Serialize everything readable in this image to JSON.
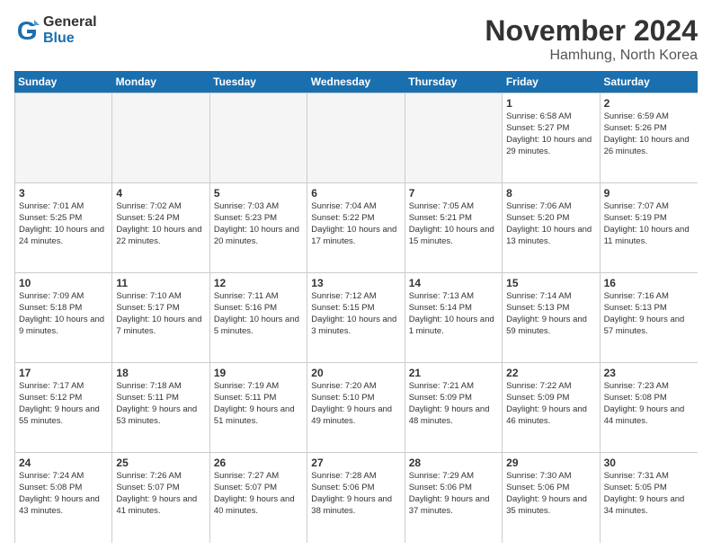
{
  "logo": {
    "general": "General",
    "blue": "Blue"
  },
  "header": {
    "month": "November 2024",
    "location": "Hamhung, North Korea"
  },
  "weekdays": [
    "Sunday",
    "Monday",
    "Tuesday",
    "Wednesday",
    "Thursday",
    "Friday",
    "Saturday"
  ],
  "weeks": [
    [
      {
        "day": "",
        "empty": true
      },
      {
        "day": "",
        "empty": true
      },
      {
        "day": "",
        "empty": true
      },
      {
        "day": "",
        "empty": true
      },
      {
        "day": "",
        "empty": true
      },
      {
        "day": "1",
        "sunrise": "Sunrise: 6:58 AM",
        "sunset": "Sunset: 5:27 PM",
        "daylight": "Daylight: 10 hours and 29 minutes."
      },
      {
        "day": "2",
        "sunrise": "Sunrise: 6:59 AM",
        "sunset": "Sunset: 5:26 PM",
        "daylight": "Daylight: 10 hours and 26 minutes."
      }
    ],
    [
      {
        "day": "3",
        "sunrise": "Sunrise: 7:01 AM",
        "sunset": "Sunset: 5:25 PM",
        "daylight": "Daylight: 10 hours and 24 minutes."
      },
      {
        "day": "4",
        "sunrise": "Sunrise: 7:02 AM",
        "sunset": "Sunset: 5:24 PM",
        "daylight": "Daylight: 10 hours and 22 minutes."
      },
      {
        "day": "5",
        "sunrise": "Sunrise: 7:03 AM",
        "sunset": "Sunset: 5:23 PM",
        "daylight": "Daylight: 10 hours and 20 minutes."
      },
      {
        "day": "6",
        "sunrise": "Sunrise: 7:04 AM",
        "sunset": "Sunset: 5:22 PM",
        "daylight": "Daylight: 10 hours and 17 minutes."
      },
      {
        "day": "7",
        "sunrise": "Sunrise: 7:05 AM",
        "sunset": "Sunset: 5:21 PM",
        "daylight": "Daylight: 10 hours and 15 minutes."
      },
      {
        "day": "8",
        "sunrise": "Sunrise: 7:06 AM",
        "sunset": "Sunset: 5:20 PM",
        "daylight": "Daylight: 10 hours and 13 minutes."
      },
      {
        "day": "9",
        "sunrise": "Sunrise: 7:07 AM",
        "sunset": "Sunset: 5:19 PM",
        "daylight": "Daylight: 10 hours and 11 minutes."
      }
    ],
    [
      {
        "day": "10",
        "sunrise": "Sunrise: 7:09 AM",
        "sunset": "Sunset: 5:18 PM",
        "daylight": "Daylight: 10 hours and 9 minutes."
      },
      {
        "day": "11",
        "sunrise": "Sunrise: 7:10 AM",
        "sunset": "Sunset: 5:17 PM",
        "daylight": "Daylight: 10 hours and 7 minutes."
      },
      {
        "day": "12",
        "sunrise": "Sunrise: 7:11 AM",
        "sunset": "Sunset: 5:16 PM",
        "daylight": "Daylight: 10 hours and 5 minutes."
      },
      {
        "day": "13",
        "sunrise": "Sunrise: 7:12 AM",
        "sunset": "Sunset: 5:15 PM",
        "daylight": "Daylight: 10 hours and 3 minutes."
      },
      {
        "day": "14",
        "sunrise": "Sunrise: 7:13 AM",
        "sunset": "Sunset: 5:14 PM",
        "daylight": "Daylight: 10 hours and 1 minute."
      },
      {
        "day": "15",
        "sunrise": "Sunrise: 7:14 AM",
        "sunset": "Sunset: 5:13 PM",
        "daylight": "Daylight: 9 hours and 59 minutes."
      },
      {
        "day": "16",
        "sunrise": "Sunrise: 7:16 AM",
        "sunset": "Sunset: 5:13 PM",
        "daylight": "Daylight: 9 hours and 57 minutes."
      }
    ],
    [
      {
        "day": "17",
        "sunrise": "Sunrise: 7:17 AM",
        "sunset": "Sunset: 5:12 PM",
        "daylight": "Daylight: 9 hours and 55 minutes."
      },
      {
        "day": "18",
        "sunrise": "Sunrise: 7:18 AM",
        "sunset": "Sunset: 5:11 PM",
        "daylight": "Daylight: 9 hours and 53 minutes."
      },
      {
        "day": "19",
        "sunrise": "Sunrise: 7:19 AM",
        "sunset": "Sunset: 5:11 PM",
        "daylight": "Daylight: 9 hours and 51 minutes."
      },
      {
        "day": "20",
        "sunrise": "Sunrise: 7:20 AM",
        "sunset": "Sunset: 5:10 PM",
        "daylight": "Daylight: 9 hours and 49 minutes."
      },
      {
        "day": "21",
        "sunrise": "Sunrise: 7:21 AM",
        "sunset": "Sunset: 5:09 PM",
        "daylight": "Daylight: 9 hours and 48 minutes."
      },
      {
        "day": "22",
        "sunrise": "Sunrise: 7:22 AM",
        "sunset": "Sunset: 5:09 PM",
        "daylight": "Daylight: 9 hours and 46 minutes."
      },
      {
        "day": "23",
        "sunrise": "Sunrise: 7:23 AM",
        "sunset": "Sunset: 5:08 PM",
        "daylight": "Daylight: 9 hours and 44 minutes."
      }
    ],
    [
      {
        "day": "24",
        "sunrise": "Sunrise: 7:24 AM",
        "sunset": "Sunset: 5:08 PM",
        "daylight": "Daylight: 9 hours and 43 minutes."
      },
      {
        "day": "25",
        "sunrise": "Sunrise: 7:26 AM",
        "sunset": "Sunset: 5:07 PM",
        "daylight": "Daylight: 9 hours and 41 minutes."
      },
      {
        "day": "26",
        "sunrise": "Sunrise: 7:27 AM",
        "sunset": "Sunset: 5:07 PM",
        "daylight": "Daylight: 9 hours and 40 minutes."
      },
      {
        "day": "27",
        "sunrise": "Sunrise: 7:28 AM",
        "sunset": "Sunset: 5:06 PM",
        "daylight": "Daylight: 9 hours and 38 minutes."
      },
      {
        "day": "28",
        "sunrise": "Sunrise: 7:29 AM",
        "sunset": "Sunset: 5:06 PM",
        "daylight": "Daylight: 9 hours and 37 minutes."
      },
      {
        "day": "29",
        "sunrise": "Sunrise: 7:30 AM",
        "sunset": "Sunset: 5:06 PM",
        "daylight": "Daylight: 9 hours and 35 minutes."
      },
      {
        "day": "30",
        "sunrise": "Sunrise: 7:31 AM",
        "sunset": "Sunset: 5:05 PM",
        "daylight": "Daylight: 9 hours and 34 minutes."
      }
    ]
  ]
}
